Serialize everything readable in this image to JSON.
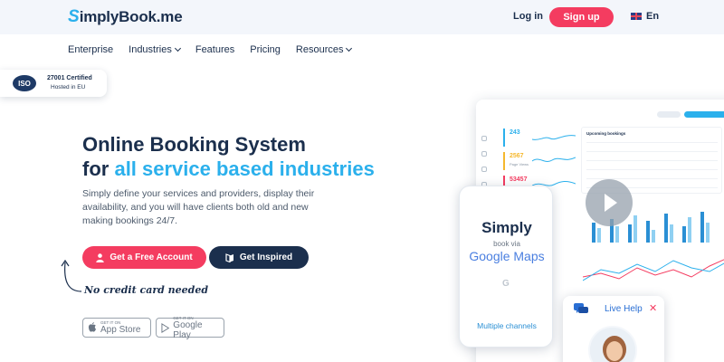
{
  "brand": {
    "logo_s": "S",
    "logo_rest": "implyBook.me",
    "accent": "#2bb0ec",
    "navy": "#1b2f4d",
    "red": "#f43c60"
  },
  "header": {
    "login": "Log in",
    "signup": "Sign up",
    "language": "En"
  },
  "nav": {
    "items": [
      {
        "label": "Enterprise",
        "dropdown": false
      },
      {
        "label": "Industries",
        "dropdown": true
      },
      {
        "label": "Features",
        "dropdown": false
      },
      {
        "label": "Pricing",
        "dropdown": false
      },
      {
        "label": "Resources",
        "dropdown": true
      }
    ]
  },
  "iso_badge": {
    "mark": "ISO",
    "line1": "27001 Certified",
    "line2": "Hosted in EU"
  },
  "hero": {
    "title_line1": "Online Booking System",
    "title_line2_prefix": "for",
    "title_line2_accent": "all service based industries",
    "description": "Simply define your services and providers, display their availability, and you will have clients both old and new making bookings 24/7.",
    "cta_primary": "Get a Free Account",
    "cta_secondary": "Get Inspired",
    "note": "No credit card needed"
  },
  "stores": {
    "app_store_top": "GET IT ON",
    "app_store": "App Store",
    "google_play_top": "GET IT ON",
    "google_play": "Google Play"
  },
  "dashboard": {
    "kpis": [
      {
        "value": "243",
        "color": "#2bb0ec"
      },
      {
        "value": "2567",
        "label": "Page Views",
        "color": "#f5b82e"
      },
      {
        "value": "53457",
        "color": "#f43c60"
      }
    ],
    "table_title": "Upcoming bookings"
  },
  "phone": {
    "title": "Simply",
    "subtitle": "book via",
    "google_maps": "Google Maps",
    "multi": "Multiple channels"
  },
  "live_help": {
    "label": "Live Help",
    "close": "✕"
  }
}
